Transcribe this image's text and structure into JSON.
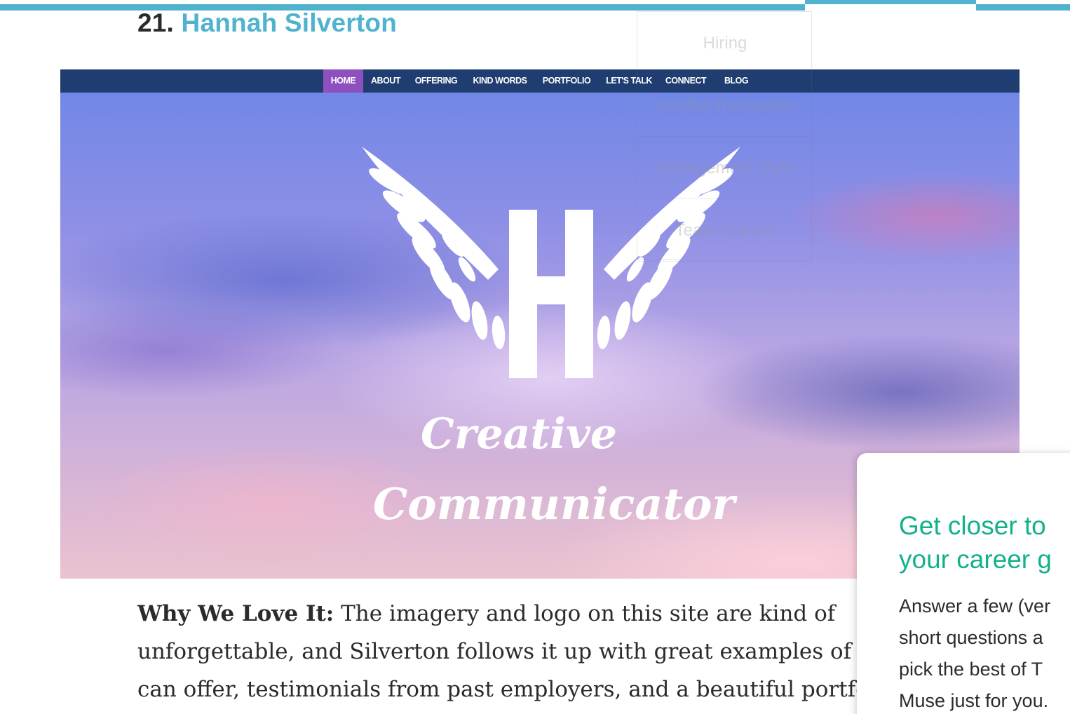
{
  "heading": {
    "number": "21.",
    "name": "Hannah Silverton"
  },
  "screenshot": {
    "nav": [
      {
        "label": "HOME",
        "active": true
      },
      {
        "label": "ABOUT"
      },
      {
        "label": "OFFERING"
      },
      {
        "label": "KIND WORDS"
      },
      {
        "label": "PORTFOLIO"
      },
      {
        "label": "LET'S TALK"
      },
      {
        "label": "CONNECT"
      },
      {
        "label": "BLOG"
      }
    ],
    "logo_letter": "H",
    "tagline_line1": "Creative",
    "tagline_line2": "Communicator"
  },
  "ghost_menu": [
    "Hiring",
    "Conflict Resolution",
    "Management Style",
    "Team Culture"
  ],
  "body": {
    "lead": "Why We Love It:",
    "line1": "The imagery and logo on this site are kind of",
    "line2": "unforgettable, and Silverton follows it up with great examples of wha",
    "line3": "can offer, testimonials from past employers, and a beautiful portfolic"
  },
  "popup": {
    "title_line1": "Get closer to",
    "title_line2": "your career g",
    "text_line1": "Answer a few (ver",
    "text_line2": "short questions a",
    "text_line3": "pick the best of T",
    "text_line4": "Muse just for you."
  },
  "colors": {
    "accent": "#4fb3ce",
    "popup_title": "#12b18b",
    "nav_bg": "#1f3d70",
    "nav_active": "#8e4fbf"
  }
}
